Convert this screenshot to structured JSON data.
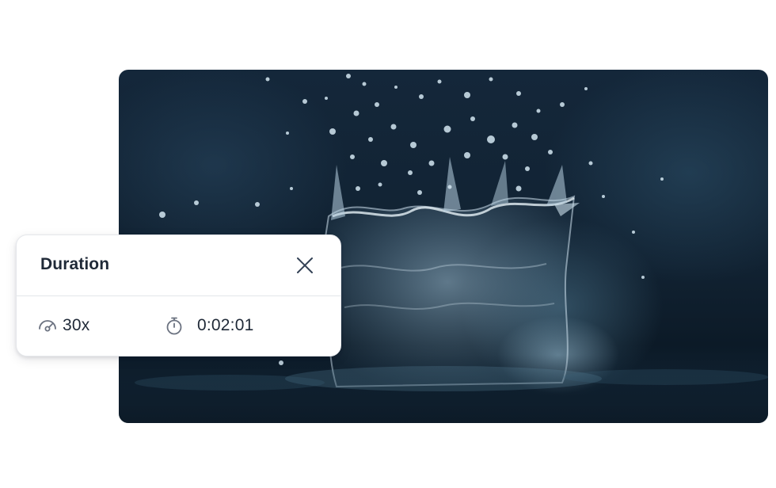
{
  "media": {
    "subject": "water splash photograph",
    "colors": {
      "deep": "#112232",
      "mid": "#2d5069",
      "highlight": "#b9d3e2"
    }
  },
  "panel": {
    "title": "Duration",
    "close_icon": "close-icon",
    "speed": {
      "icon": "speedometer-icon",
      "value": "30x"
    },
    "duration": {
      "icon": "stopwatch-icon",
      "value": "0:02:01"
    }
  }
}
